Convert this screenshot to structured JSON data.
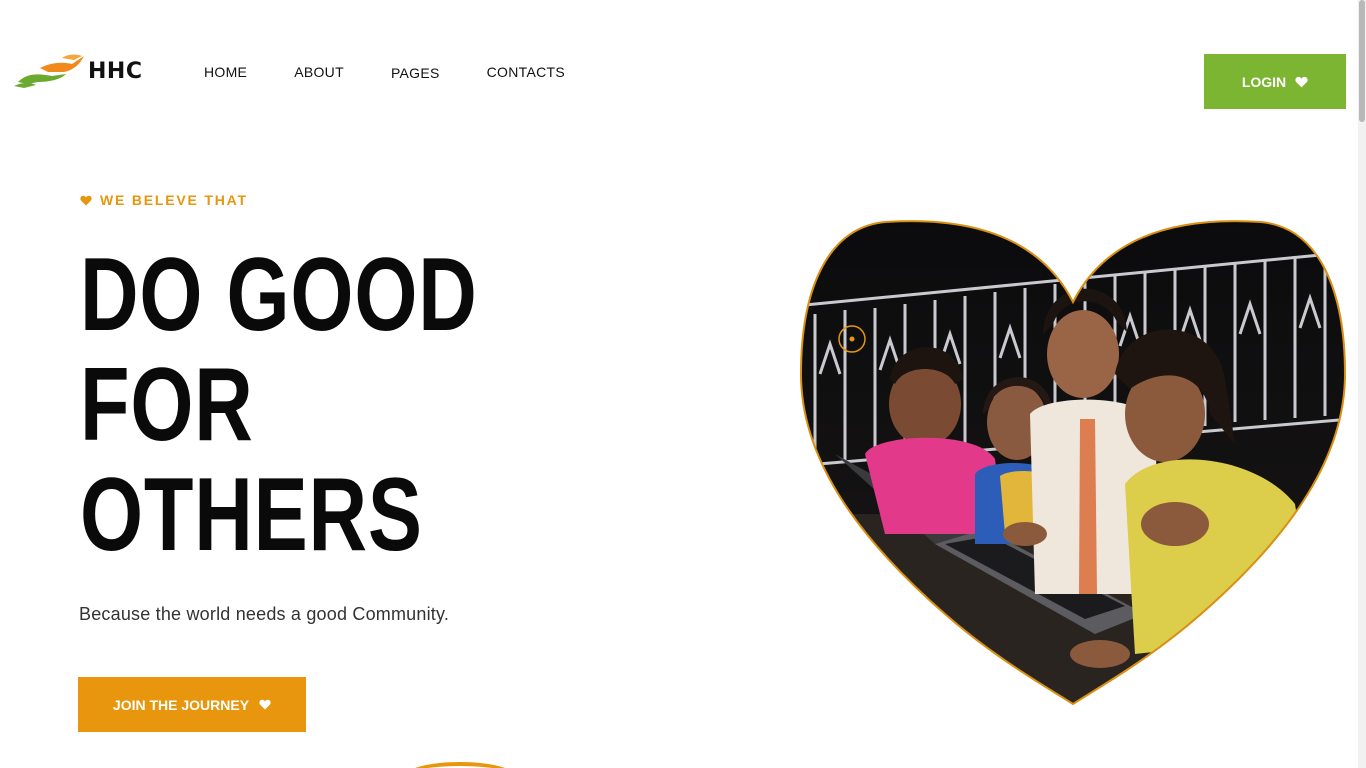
{
  "header": {
    "logo_text": "HHC",
    "nav": [
      {
        "label": "HOME"
      },
      {
        "label": "ABOUT"
      },
      {
        "label": "PAGES"
      },
      {
        "label": "CONTACTS"
      }
    ],
    "login_label": "LOGIN"
  },
  "hero": {
    "eyebrow": "WE BELEVE THAT",
    "headline": [
      "DO GOOD",
      "FOR",
      "OTHERS"
    ],
    "subtitle": "Because the world needs a good Community.",
    "cta_label": "JOIN THE JOURNEY"
  },
  "icons": {
    "heart": "heart-icon",
    "logo": "hands-logo-icon"
  },
  "colors": {
    "brand_orange": "#e8960d",
    "brand_green": "#7cb531",
    "text_dark": "#0a0a0a"
  }
}
